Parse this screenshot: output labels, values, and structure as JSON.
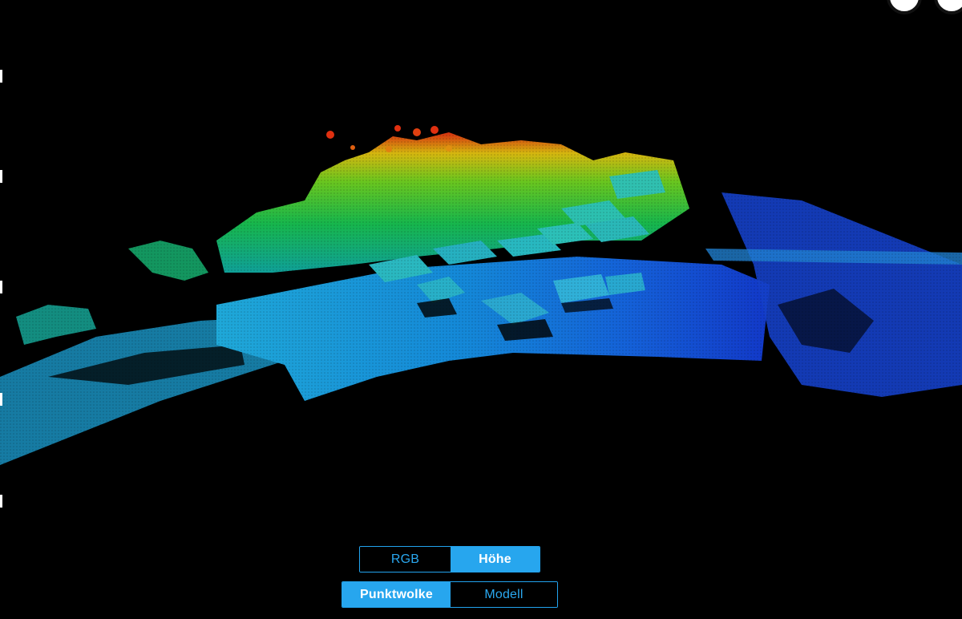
{
  "view_toggles": {
    "color_mode": {
      "options": [
        {
          "label": "RGB",
          "active": false
        },
        {
          "label": "Höhe",
          "active": true
        }
      ]
    },
    "display_mode": {
      "options": [
        {
          "label": "Punktwolke",
          "active": true
        },
        {
          "label": "Modell",
          "active": false
        }
      ]
    }
  },
  "colors": {
    "accent": "#27a6ee",
    "background": "#000000",
    "height_low": "#1530c8",
    "height_mid": "#18c060",
    "height_high": "#e02a10"
  },
  "icons": {
    "top_right_1": "camera-icon",
    "top_right_2": "fullscreen-icon"
  }
}
